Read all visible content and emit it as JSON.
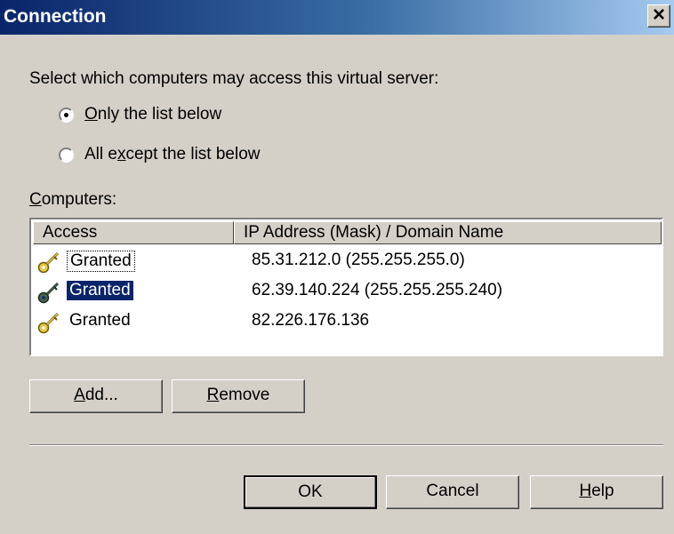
{
  "window": {
    "title": "Connection",
    "close_glyph": "×"
  },
  "prompt": "Select which computers may access this virtual server:",
  "radios": [
    {
      "pre": "",
      "accel": "O",
      "post": "nly the list below",
      "checked": true
    },
    {
      "pre": "All e",
      "accel": "x",
      "post": "cept the list below",
      "checked": false
    }
  ],
  "computers_label": {
    "accel": "C",
    "post": "omputers:"
  },
  "list": {
    "headers": [
      "Access",
      "IP Address (Mask) / Domain Name"
    ],
    "rows": [
      {
        "access": "Granted",
        "ip": "85.31.212.0 (255.255.255.0)",
        "state": "focused"
      },
      {
        "access": "Granted",
        "ip": "62.39.140.224 (255.255.255.240)",
        "state": "selected"
      },
      {
        "access": "Granted",
        "ip": "82.226.176.136",
        "state": "normal"
      }
    ]
  },
  "buttons": {
    "add": {
      "accel": "A",
      "post": "dd..."
    },
    "remove": {
      "accel": "R",
      "post": "emove"
    },
    "ok": "OK",
    "cancel": "Cancel",
    "help": {
      "accel": "H",
      "post": "elp"
    }
  },
  "icons": {
    "key": "key-icon"
  },
  "colors": {
    "selection": "#0a246a",
    "title_start": "#0a246a",
    "title_end": "#a6caf0"
  }
}
